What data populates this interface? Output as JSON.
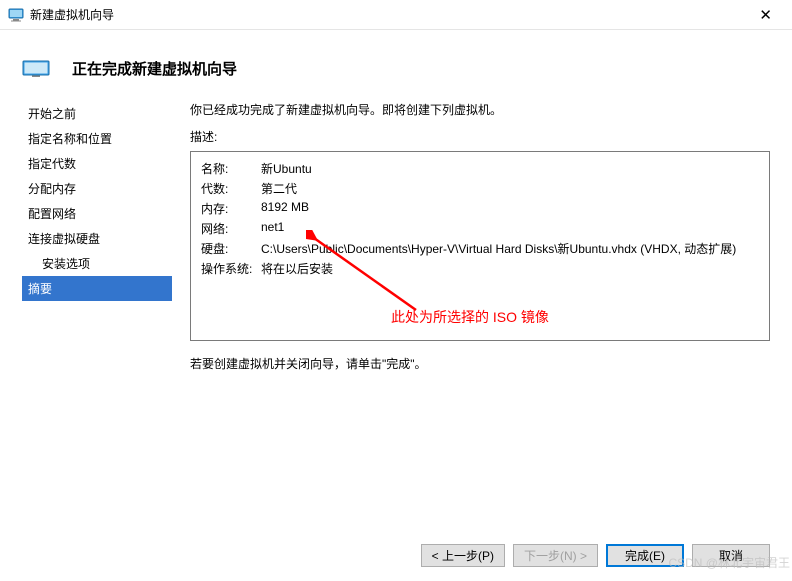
{
  "window": {
    "title": "新建虚拟机向导"
  },
  "header": {
    "title": "正在完成新建虚拟机向导"
  },
  "sidebar": {
    "items": [
      {
        "label": "开始之前",
        "indent": false,
        "selected": false
      },
      {
        "label": "指定名称和位置",
        "indent": false,
        "selected": false
      },
      {
        "label": "指定代数",
        "indent": false,
        "selected": false
      },
      {
        "label": "分配内存",
        "indent": false,
        "selected": false
      },
      {
        "label": "配置网络",
        "indent": false,
        "selected": false
      },
      {
        "label": "连接虚拟硬盘",
        "indent": false,
        "selected": false
      },
      {
        "label": "安装选项",
        "indent": true,
        "selected": false
      },
      {
        "label": "摘要",
        "indent": false,
        "selected": true
      }
    ]
  },
  "content": {
    "intro": "你已经成功完成了新建虚拟机向导。即将创建下列虚拟机。",
    "desc_label": "描述:",
    "summary": [
      {
        "key": "名称:",
        "val": "新Ubuntu"
      },
      {
        "key": "代数:",
        "val": "第二代"
      },
      {
        "key": "内存:",
        "val": "8192 MB"
      },
      {
        "key": "网络:",
        "val": "net1"
      },
      {
        "key": "硬盘:",
        "val": "C:\\Users\\Public\\Documents\\Hyper-V\\Virtual Hard Disks\\新Ubuntu.vhdx (VHDX, 动态扩展)"
      },
      {
        "key": "操作系统:",
        "val": "将在以后安装"
      }
    ],
    "annotation": "此处为所选择的 ISO 镜像",
    "outro": "若要创建虚拟机并关闭向导，请单击\"完成\"。"
  },
  "buttons": {
    "prev": "< 上一步(P)",
    "next": "下一步(N) >",
    "finish": "完成(E)",
    "cancel": "取消"
  },
  "watermark": "CSDN @林北宇宙君王"
}
